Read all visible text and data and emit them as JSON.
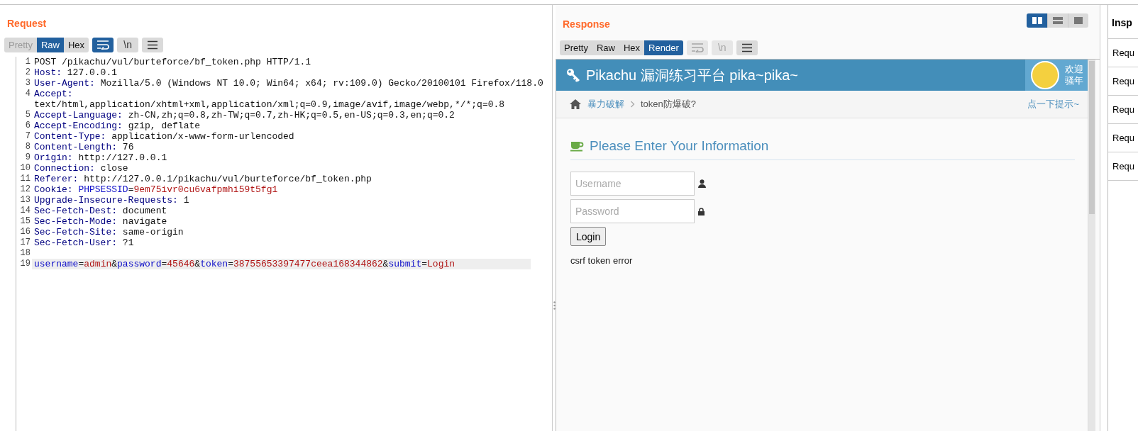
{
  "request": {
    "title": "Request",
    "tabs": [
      {
        "label": "Pretty",
        "selected": false,
        "disabled": true
      },
      {
        "label": "Raw",
        "selected": true,
        "disabled": false
      },
      {
        "label": "Hex",
        "selected": false,
        "disabled": false
      }
    ],
    "tools": [
      {
        "kind": "wrap",
        "on": true,
        "disabled": false
      },
      {
        "kind": "newline",
        "label": "\\n",
        "on": false,
        "disabled": false
      },
      {
        "kind": "menu",
        "on": false,
        "disabled": false
      }
    ],
    "lines": [
      {
        "number": "1",
        "current": false,
        "parts": [
          {
            "text": "POST /pikachu/vul/burteforce/bf_token.php HTTP/1.1",
            "kind": "plain"
          }
        ]
      },
      {
        "number": "2",
        "current": false,
        "parts": [
          {
            "text": "Host:",
            "kind": "key"
          },
          {
            "text": " 127.0.0.1",
            "kind": "plain"
          }
        ]
      },
      {
        "number": "3",
        "current": false,
        "parts": [
          {
            "text": "User-Agent:",
            "kind": "key"
          },
          {
            "text": " Mozilla/5.0 (Windows NT 10.0; Win64; x64; rv:109.0) Gecko/20100101 Firefox/118.0",
            "kind": "plain"
          }
        ]
      },
      {
        "number": "4",
        "current": false,
        "parts": [
          {
            "text": "Accept:",
            "kind": "key"
          },
          {
            "text": " text/html,application/xhtml+xml,application/xml;q=0.9,image/avif,image/webp,*/*;q=0.8",
            "kind": "plain"
          }
        ]
      },
      {
        "number": "5",
        "current": false,
        "parts": [
          {
            "text": "Accept-Language:",
            "kind": "key"
          },
          {
            "text": " zh-CN,zh;q=0.8,zh-TW;q=0.7,zh-HK;q=0.5,en-US;q=0.3,en;q=0.2",
            "kind": "plain"
          }
        ]
      },
      {
        "number": "6",
        "current": false,
        "parts": [
          {
            "text": "Accept-Encoding:",
            "kind": "key"
          },
          {
            "text": " gzip, deflate",
            "kind": "plain"
          }
        ]
      },
      {
        "number": "7",
        "current": false,
        "parts": [
          {
            "text": "Content-Type:",
            "kind": "key"
          },
          {
            "text": " application/x-www-form-urlencoded",
            "kind": "plain"
          }
        ]
      },
      {
        "number": "8",
        "current": false,
        "parts": [
          {
            "text": "Content-Length:",
            "kind": "key"
          },
          {
            "text": " 76",
            "kind": "plain"
          }
        ]
      },
      {
        "number": "9",
        "current": false,
        "parts": [
          {
            "text": "Origin:",
            "kind": "key"
          },
          {
            "text": " http://127.0.0.1",
            "kind": "plain"
          }
        ]
      },
      {
        "number": "10",
        "current": false,
        "parts": [
          {
            "text": "Connection:",
            "kind": "key"
          },
          {
            "text": " close",
            "kind": "plain"
          }
        ]
      },
      {
        "number": "11",
        "current": false,
        "parts": [
          {
            "text": "Referer:",
            "kind": "key"
          },
          {
            "text": " http://127.0.0.1/pikachu/vul/burteforce/bf_token.php",
            "kind": "plain"
          }
        ]
      },
      {
        "number": "12",
        "current": false,
        "parts": [
          {
            "text": "Cookie:",
            "kind": "key"
          },
          {
            "text": " PHPSESSID",
            "kind": "param"
          },
          {
            "text": "=",
            "kind": "plain"
          },
          {
            "text": "9em75ivr0cu6vafpmhi59t5fg1",
            "kind": "value"
          }
        ]
      },
      {
        "number": "13",
        "current": false,
        "parts": [
          {
            "text": "Upgrade-Insecure-Requests:",
            "kind": "key"
          },
          {
            "text": " 1",
            "kind": "plain"
          }
        ]
      },
      {
        "number": "14",
        "current": false,
        "parts": [
          {
            "text": "Sec-Fetch-Dest:",
            "kind": "key"
          },
          {
            "text": " document",
            "kind": "plain"
          }
        ]
      },
      {
        "number": "15",
        "current": false,
        "parts": [
          {
            "text": "Sec-Fetch-Mode:",
            "kind": "key"
          },
          {
            "text": " navigate",
            "kind": "plain"
          }
        ]
      },
      {
        "number": "16",
        "current": false,
        "parts": [
          {
            "text": "Sec-Fetch-Site:",
            "kind": "key"
          },
          {
            "text": " same-origin",
            "kind": "plain"
          }
        ]
      },
      {
        "number": "17",
        "current": false,
        "parts": [
          {
            "text": "Sec-Fetch-User:",
            "kind": "key"
          },
          {
            "text": " ?1",
            "kind": "plain"
          }
        ]
      },
      {
        "number": "18",
        "current": false
      },
      {
        "number": "19",
        "current": true,
        "parts": [
          {
            "text": "username",
            "kind": "param"
          },
          {
            "text": "=",
            "kind": "plain"
          },
          {
            "text": "admin",
            "kind": "value"
          },
          {
            "text": "&",
            "kind": "plain"
          },
          {
            "text": "password",
            "kind": "param"
          },
          {
            "text": "=",
            "kind": "plain"
          },
          {
            "text": "45646",
            "kind": "value"
          },
          {
            "text": "&",
            "kind": "plain"
          },
          {
            "text": "token",
            "kind": "param"
          },
          {
            "text": "=",
            "kind": "plain"
          },
          {
            "text": "38755653397477ceea168344862",
            "kind": "value"
          },
          {
            "text": "&",
            "kind": "plain"
          },
          {
            "text": "submit",
            "kind": "param"
          },
          {
            "text": "=",
            "kind": "plain"
          },
          {
            "text": "Login",
            "kind": "value"
          }
        ]
      }
    ]
  },
  "response": {
    "title": "Response",
    "layout_toggle": [
      {
        "kind": "split",
        "selected": true
      },
      {
        "kind": "stacked",
        "selected": false
      },
      {
        "kind": "single",
        "selected": false
      }
    ],
    "tabs": [
      {
        "label": "Pretty",
        "selected": false,
        "disabled": false
      },
      {
        "label": "Raw",
        "selected": false,
        "disabled": false
      },
      {
        "label": "Hex",
        "selected": false,
        "disabled": false
      },
      {
        "label": "Render",
        "selected": true,
        "disabled": false
      }
    ],
    "tools": [
      {
        "kind": "wrap",
        "on": false,
        "disabled": true
      },
      {
        "kind": "newline",
        "label": "\\n",
        "on": false,
        "disabled": true
      },
      {
        "kind": "menu",
        "on": false,
        "disabled": false
      }
    ],
    "render": {
      "site_title": "Pikachu 漏洞练习平台 pika~pika~",
      "greeting": "欢迎骚年",
      "breadcrumb": [
        {
          "label": "暴力破解",
          "kind": "link"
        },
        {
          "label": "token防爆破?",
          "kind": "current"
        }
      ],
      "hint_link": "点一下提示~",
      "form": {
        "heading": "Please Enter Your Information",
        "fields": [
          {
            "placeholder": "Username",
            "kind": "user"
          },
          {
            "placeholder": "Password",
            "kind": "lock"
          }
        ],
        "button": "Login",
        "message": "csrf token error"
      }
    }
  },
  "inspector": {
    "title": "Insp",
    "rows": [
      "Requ",
      "Requ",
      "Requ",
      "Requ",
      "Requ"
    ]
  }
}
